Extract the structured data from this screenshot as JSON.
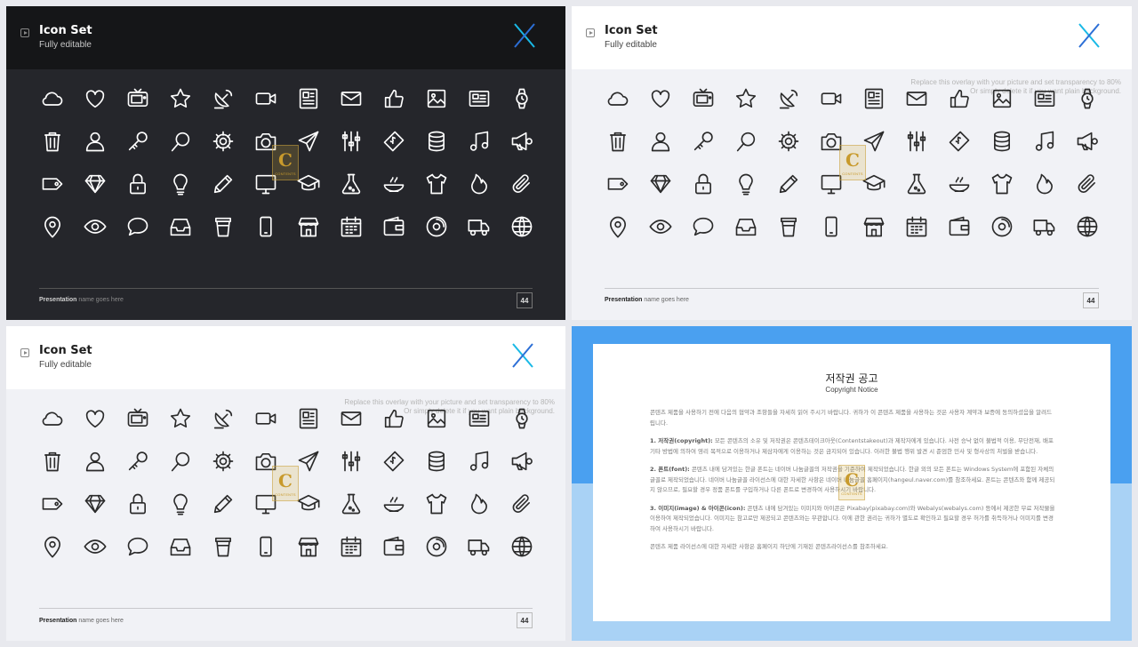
{
  "slides": [
    {
      "theme": "dark",
      "title": "Icon Set",
      "subtitle": "Fully editable",
      "overlay_line1": "",
      "overlay_line2": "",
      "footer_bold": "Presentation",
      "footer_rest": " name goes here",
      "page": "44"
    },
    {
      "theme": "light",
      "title": "Icon Set",
      "subtitle": "Fully editable",
      "overlay_line1": "Replace this overlay with your picture and set transparency to 80%",
      "overlay_line2": "Or simply delete it if you want plain background.",
      "footer_bold": "Presentation",
      "footer_rest": " name goes here",
      "page": "44"
    },
    {
      "theme": "light",
      "title": "Icon Set",
      "subtitle": "Fully editable",
      "overlay_line1": "Replace this overlay with your picture and set transparency to 80%",
      "overlay_line2": "Or simply delete it if you want plain background.",
      "footer_bold": "Presentation",
      "footer_rest": " name goes here",
      "page": "44"
    }
  ],
  "icons": [
    "cloud-icon",
    "heart-icon",
    "tv-icon",
    "star-icon",
    "satellite-dish-icon",
    "video-camera-icon",
    "newspaper-icon",
    "envelope-icon",
    "thumbs-up-icon",
    "picture-icon",
    "article-icon",
    "watch-icon",
    "trash-icon",
    "user-icon",
    "key-icon",
    "magnifier-icon",
    "gear-icon",
    "camera-icon",
    "paper-plane-icon",
    "sliders-icon",
    "money-icon",
    "database-icon",
    "music-note-icon",
    "megaphone-icon",
    "tag-icon",
    "diamond-icon",
    "lock-icon",
    "lightbulb-icon",
    "pencil-icon",
    "monitor-icon",
    "graduation-cap-icon",
    "flask-icon",
    "food-bowl-icon",
    "tshirt-icon",
    "fire-icon",
    "paperclip-icon",
    "map-pin-icon",
    "eye-icon",
    "speech-bubble-icon",
    "inbox-icon",
    "coffee-cup-icon",
    "smartphone-icon",
    "shop-icon",
    "calendar-icon",
    "wallet-icon",
    "disc-icon",
    "truck-icon",
    "globe-icon"
  ],
  "watermark": {
    "letter": "C",
    "text": "CONTENTS"
  },
  "copyright": {
    "title": "저작권 공고",
    "subtitle": "Copyright Notice",
    "intro": "콘텐츠 제품을 사용하기 전에 다음의 협약과 조항들을 자세히 읽어 주시기 바랍니다. 귀하가 이 콘텐츠 제품을 사용하는 것은 사용자 계약과 보증에 동의하셨음을 알려드립니다.",
    "p1_head": "1. 저작권(copyright):",
    "p1": " 모든 콘텐츠의 소유 및 저작권은 콘텐츠테이크아웃(Contentstakeout)과 제작자에게 있습니다. 사전 승낙 없이 불법적 이용, 무단전재, 배포 기타 방법에 의하여 영리 목적으로 이용하거나 제삼자에게 이용하는 것은 금지되어 있습니다. 이러한 불법 행위 발견 시 준엄한 민사 및 형사상의 처벌을 받습니다.",
    "p2_head": "2. 폰트(font):",
    "p2": " 콘텐츠 내에 담겨있는 한글 폰트는 네이버 나눔글꼴의 저작권을 기준하여 제작되었습니다. 한글 외의 모든 폰트는 Windows System에 포함된 자체의 글꼴로 제작되었습니다. 네이버 나눔글꼴 라이선스에 대한 자세한 사항은 네이버 나눔글꼴 홈페이지(hangeul.naver.com)를 참조하세요. 폰트는 콘텐츠와 함께 제공되지 않으므로, 필요할 경우 정품 폰트를 구입하거나 다른 폰트로 변경하여 사용하시기 바랍니다.",
    "p3_head": "3. 이미지(image) & 아이콘(icon):",
    "p3": " 콘텐츠 내에 담겨있는 이미지와 아이콘은 Pixabay(pixabay.com)와 Webalys(webalys.com) 등에서 제공한 무료 저작물을 이용하여 제작되었습니다. 이미지는 참고로만 제공되고 콘텐츠와는 무관합니다. 이에 관한 권리는 귀하가 별도로 확인하고 필요할 경우 허가를 취득하거나 이미지를 변경하여 사용하시기 바랍니다.",
    "outro": "콘텐츠 제품 라이선스에 대한 자세한 사항은 홈페이지 하단에 기재된 콘텐츠라이선스를 참조하세요."
  },
  "colors": {
    "dark_bg": "#25262b",
    "dark_header": "#151618",
    "light_bg": "#f1f2f6",
    "blue": "#4aa0f0",
    "light_blue": "#a9d2f5",
    "logo_cyan": "#19b9e6",
    "logo_blue": "#2c6fd6"
  }
}
